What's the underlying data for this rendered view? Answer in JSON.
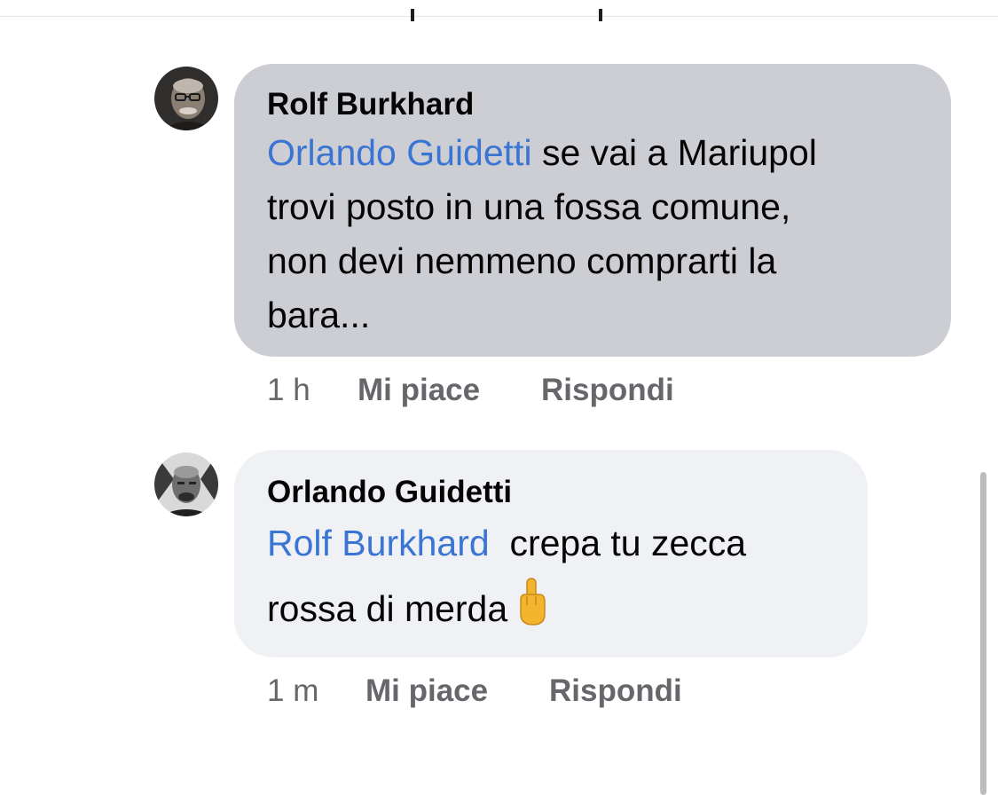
{
  "comments": [
    {
      "author": "Rolf Burkhard",
      "mention": "Orlando Guidetti",
      "text_line1": " se vai a Mariupol",
      "text_line2": "trovi posto in una fossa comune,",
      "text_line3": "non devi nemmeno comprarti la",
      "text_line4": "bara...",
      "time": "1 h",
      "like_label": "Mi piace",
      "reply_label": "Rispondi"
    },
    {
      "author": "Orlando Guidetti",
      "mention": "Rolf Burkhard",
      "text_line1": "  crepa tu zecca",
      "text_line2": "rossa di merda",
      "emoji": "middle-finger-emoji",
      "time": "1 m",
      "like_label": "Mi piace",
      "reply_label": "Rispondi"
    }
  ],
  "colors": {
    "bubble_highlighted": "#cdced3",
    "bubble_normal": "#f0f1f5",
    "mention": "#3b75d3",
    "meta_text": "#65676b"
  }
}
